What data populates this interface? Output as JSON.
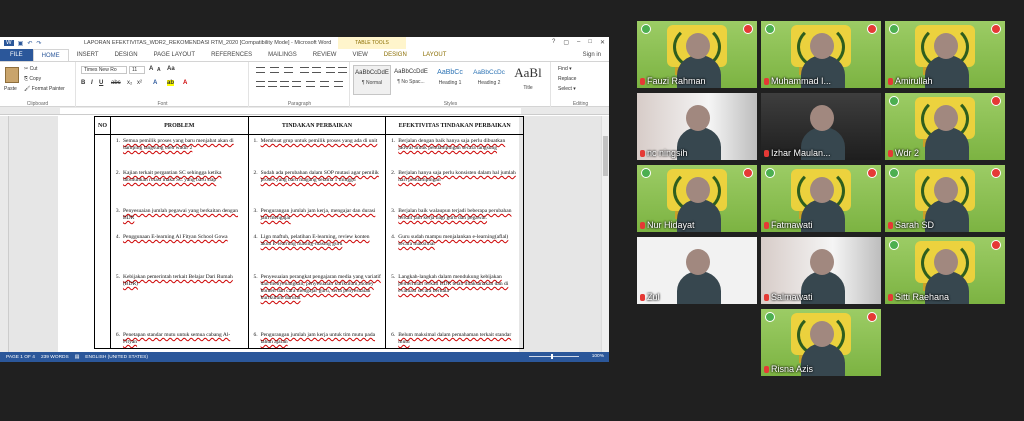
{
  "word": {
    "title": "LAPORAN EFEKTIVITAS_WDR2_REKOMENDASI RTM_2020 [Compatibility Mode] - Microsoft Word",
    "table_tools": "TABLE TOOLS",
    "window_controls": [
      "?",
      "▢",
      "–",
      "□",
      "✕"
    ],
    "tabs": [
      "FILE",
      "HOME",
      "INSERT",
      "DESIGN",
      "PAGE LAYOUT",
      "REFERENCES",
      "MAILINGS",
      "REVIEW",
      "VIEW",
      "DESIGN",
      "LAYOUT"
    ],
    "sign_in": "Sign in",
    "clipboard": {
      "paste": "Paste",
      "cut": "Cut",
      "copy": "Copy",
      "format_painter": "Format Painter",
      "label": "Clipboard"
    },
    "font": {
      "name": "Times New Ro",
      "size": "11",
      "label": "Font"
    },
    "paragraph_label": "Paragraph",
    "styles": [
      {
        "sample": "AaBbCcDdE",
        "name": "¶ Normal"
      },
      {
        "sample": "AaBbCcDdE",
        "name": "¶ No Spac..."
      },
      {
        "sample": "AaBbCc",
        "name": "Heading 1"
      },
      {
        "sample": "AaBbCcDc",
        "name": "Heading 2"
      },
      {
        "sample": "AaBl",
        "name": "Title"
      }
    ],
    "styles_label": "Styles",
    "editing": {
      "find": "Find ▾",
      "replace": "Replace",
      "select": "Select ▾",
      "label": "Editing"
    },
    "table": {
      "headers": [
        "NO",
        "PROBLEM",
        "TINDAKAN PERBAIKAN",
        "EFEKTIVITAS TINDAKAN PERBAIKAN"
      ],
      "problem": [
        "Semua pemilik proses yang baru menjabat akan di damping langsung oleh wadir 2",
        "Kajian terkait pergantian SC sehingga ketika dibutuhkan rotasi maka SC yang baru siap",
        "Penyesuaian jumlah pegawai yang berkaitan dengan BDR",
        "Penggunaan E-learning Al Fityan School Gowa",
        "Kebijakan pemerintah terkait Belajar Dari Rumah (BDR)",
        "Penetapan standar mutu untuk semua cabang Al-Fityan"
      ],
      "tindakan": [
        "Membuat grup untuk pemilik proses yang ada di unit",
        "Sudah ada perubahan dalam SOP mutasi agar pemilik proses yang baru magang selama 1 minggu",
        "Pengurangan jumlah jam kerja, mengajar dan durasi jam mengajar",
        "Lign maftuh, pelatihan E-learning, review konten akun E-learning masing-masing guru",
        "Penyesuaian perangkat pengajaran media yang variatif dan menyenangkan, penyesuaian kurikulum,money konten dan cara mengajar guru, serta penyesuaian kurikulum darurat",
        "Pengurangan jumlah jam kerja untuk tim mutu pada tahun ajaran"
      ],
      "efektivitas": [
        "Berjalan dengan baik hanya saja perlu dibuatkan jadwal untuk pendampingan secara langsung",
        "Berjalan hanya saja perlu konsisten dalam hal jumlah hari pendampingan",
        "Berjalan baik walaupun terjadi beberapa perubahan terkait jam kerja bagi guru dan pegawai.",
        "Guru sudah mampu menjalankan e-learning(aflal) secara maksimal",
        "Langkah-langkah dalam mendukung kebijakan pemerintah terkait BDR telah dilaksanakan dan di evaluasi secara berkala",
        "Belum maksimal dalam pemahaman terkait standar mutu"
      ]
    },
    "status": {
      "page": "PAGE 1 OF 4",
      "words": "239 WORDS",
      "language": "ENGLISH (UNITED STATES)",
      "zoom": "100%"
    }
  },
  "participants": [
    {
      "name": "Fauzi Rahman",
      "type": "banner",
      "muted": true
    },
    {
      "name": "Muhammad I...",
      "type": "banner",
      "muted": true
    },
    {
      "name": "Amirullah",
      "type": "banner",
      "muted": true
    },
    {
      "name": "nc ningsih",
      "type": "room",
      "muted": true
    },
    {
      "name": "Izhar Maulan...",
      "type": "dark",
      "muted": true
    },
    {
      "name": "Wdr 2",
      "type": "banner",
      "muted": true
    },
    {
      "name": "Nur Hidayat",
      "type": "banner",
      "muted": true
    },
    {
      "name": "Fatmawati",
      "type": "banner",
      "muted": true
    },
    {
      "name": "Sarah SD",
      "type": "banner",
      "muted": true
    },
    {
      "name": "Zul",
      "type": "white",
      "muted": true
    },
    {
      "name": "Salmawati",
      "type": "room",
      "muted": true
    },
    {
      "name": "Sitti Raehana",
      "type": "banner",
      "muted": true
    },
    {
      "name": "Risna Azis",
      "type": "banner",
      "muted": true
    }
  ],
  "colors": {
    "word_blue": "#2b579a",
    "tile_green": "#8bc34a",
    "mic_red": "#e53935"
  }
}
